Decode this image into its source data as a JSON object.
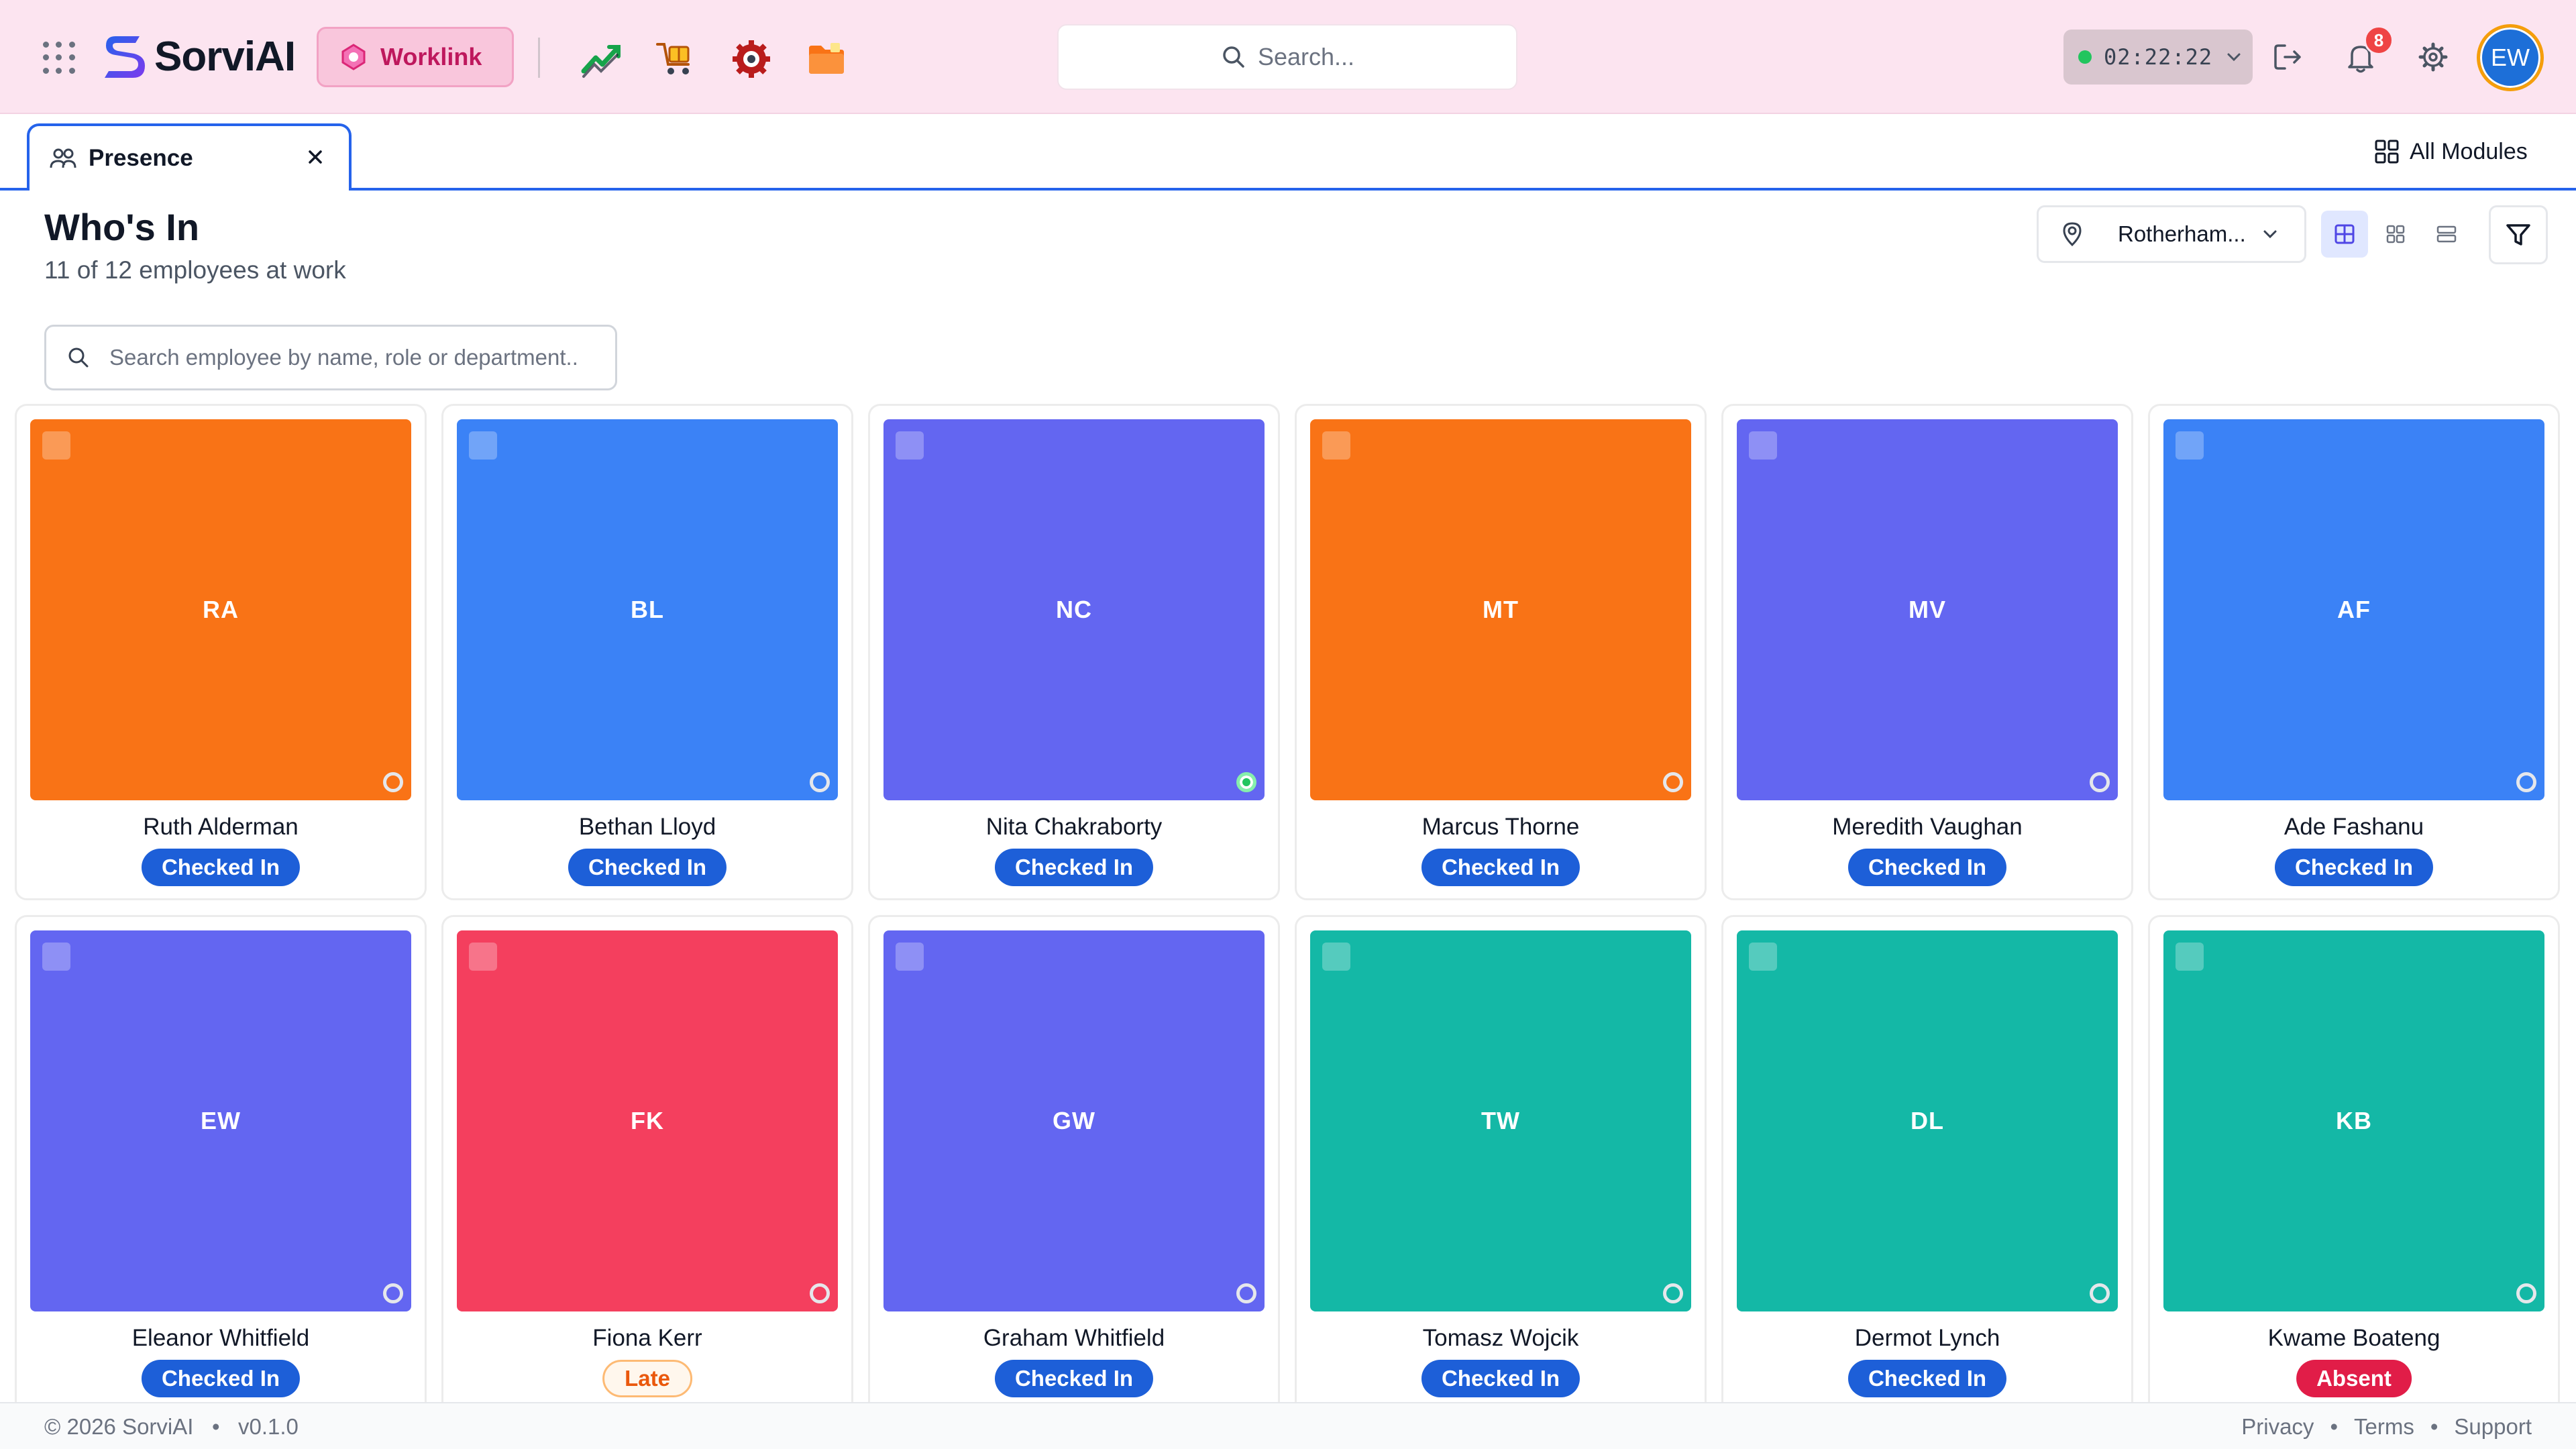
{
  "header": {
    "app_name": "SorviAI",
    "active_app": "Worklink",
    "search_placeholder": "Search...",
    "timer": "02:22:22",
    "notification_count": "8",
    "user_initials": "EW"
  },
  "tabs": [
    {
      "label": "Presence"
    }
  ],
  "all_modules_label": "All Modules",
  "page": {
    "title": "Who's In",
    "subtitle": "11 of 12 employees at work",
    "location": "Rotherham...",
    "employee_search_placeholder": "Search employee by name, role or department.."
  },
  "employees": [
    {
      "initials": "RA",
      "name": "Ruth Alderman",
      "status": "Checked In",
      "color": "#f97316"
    },
    {
      "initials": "BL",
      "name": "Bethan Lloyd",
      "status": "Checked In",
      "color": "#3b82f6"
    },
    {
      "initials": "NC",
      "name": "Nita Chakraborty",
      "status": "Checked In",
      "color": "#6366f1"
    },
    {
      "initials": "MT",
      "name": "Marcus Thorne",
      "status": "Checked In",
      "color": "#f97316"
    },
    {
      "initials": "MV",
      "name": "Meredith Vaughan",
      "status": "Checked In",
      "color": "#6366f1"
    },
    {
      "initials": "AF",
      "name": "Ade Fashanu",
      "status": "Checked In",
      "color": "#3b82f6"
    },
    {
      "initials": "EW",
      "name": "Eleanor Whitfield",
      "status": "Checked In",
      "color": "#6366f1"
    },
    {
      "initials": "FK",
      "name": "Fiona Kerr",
      "status": "Late",
      "color": "#f43f5e"
    },
    {
      "initials": "GW",
      "name": "Graham Whitfield",
      "status": "Checked In",
      "color": "#6366f1"
    },
    {
      "initials": "TW",
      "name": "Tomasz Wojcik",
      "status": "Checked In",
      "color": "#14b8a6"
    },
    {
      "initials": "DL",
      "name": "Dermot Lynch",
      "status": "Checked In",
      "color": "#14b8a6"
    },
    {
      "initials": "KB",
      "name": "Kwame Boateng",
      "status": "Absent",
      "color": "#14b8a6"
    }
  ],
  "footer": {
    "copyright": "© 2026 SorviAI",
    "version": "v0.1.0",
    "links": [
      "Privacy",
      "Terms",
      "Support"
    ]
  }
}
